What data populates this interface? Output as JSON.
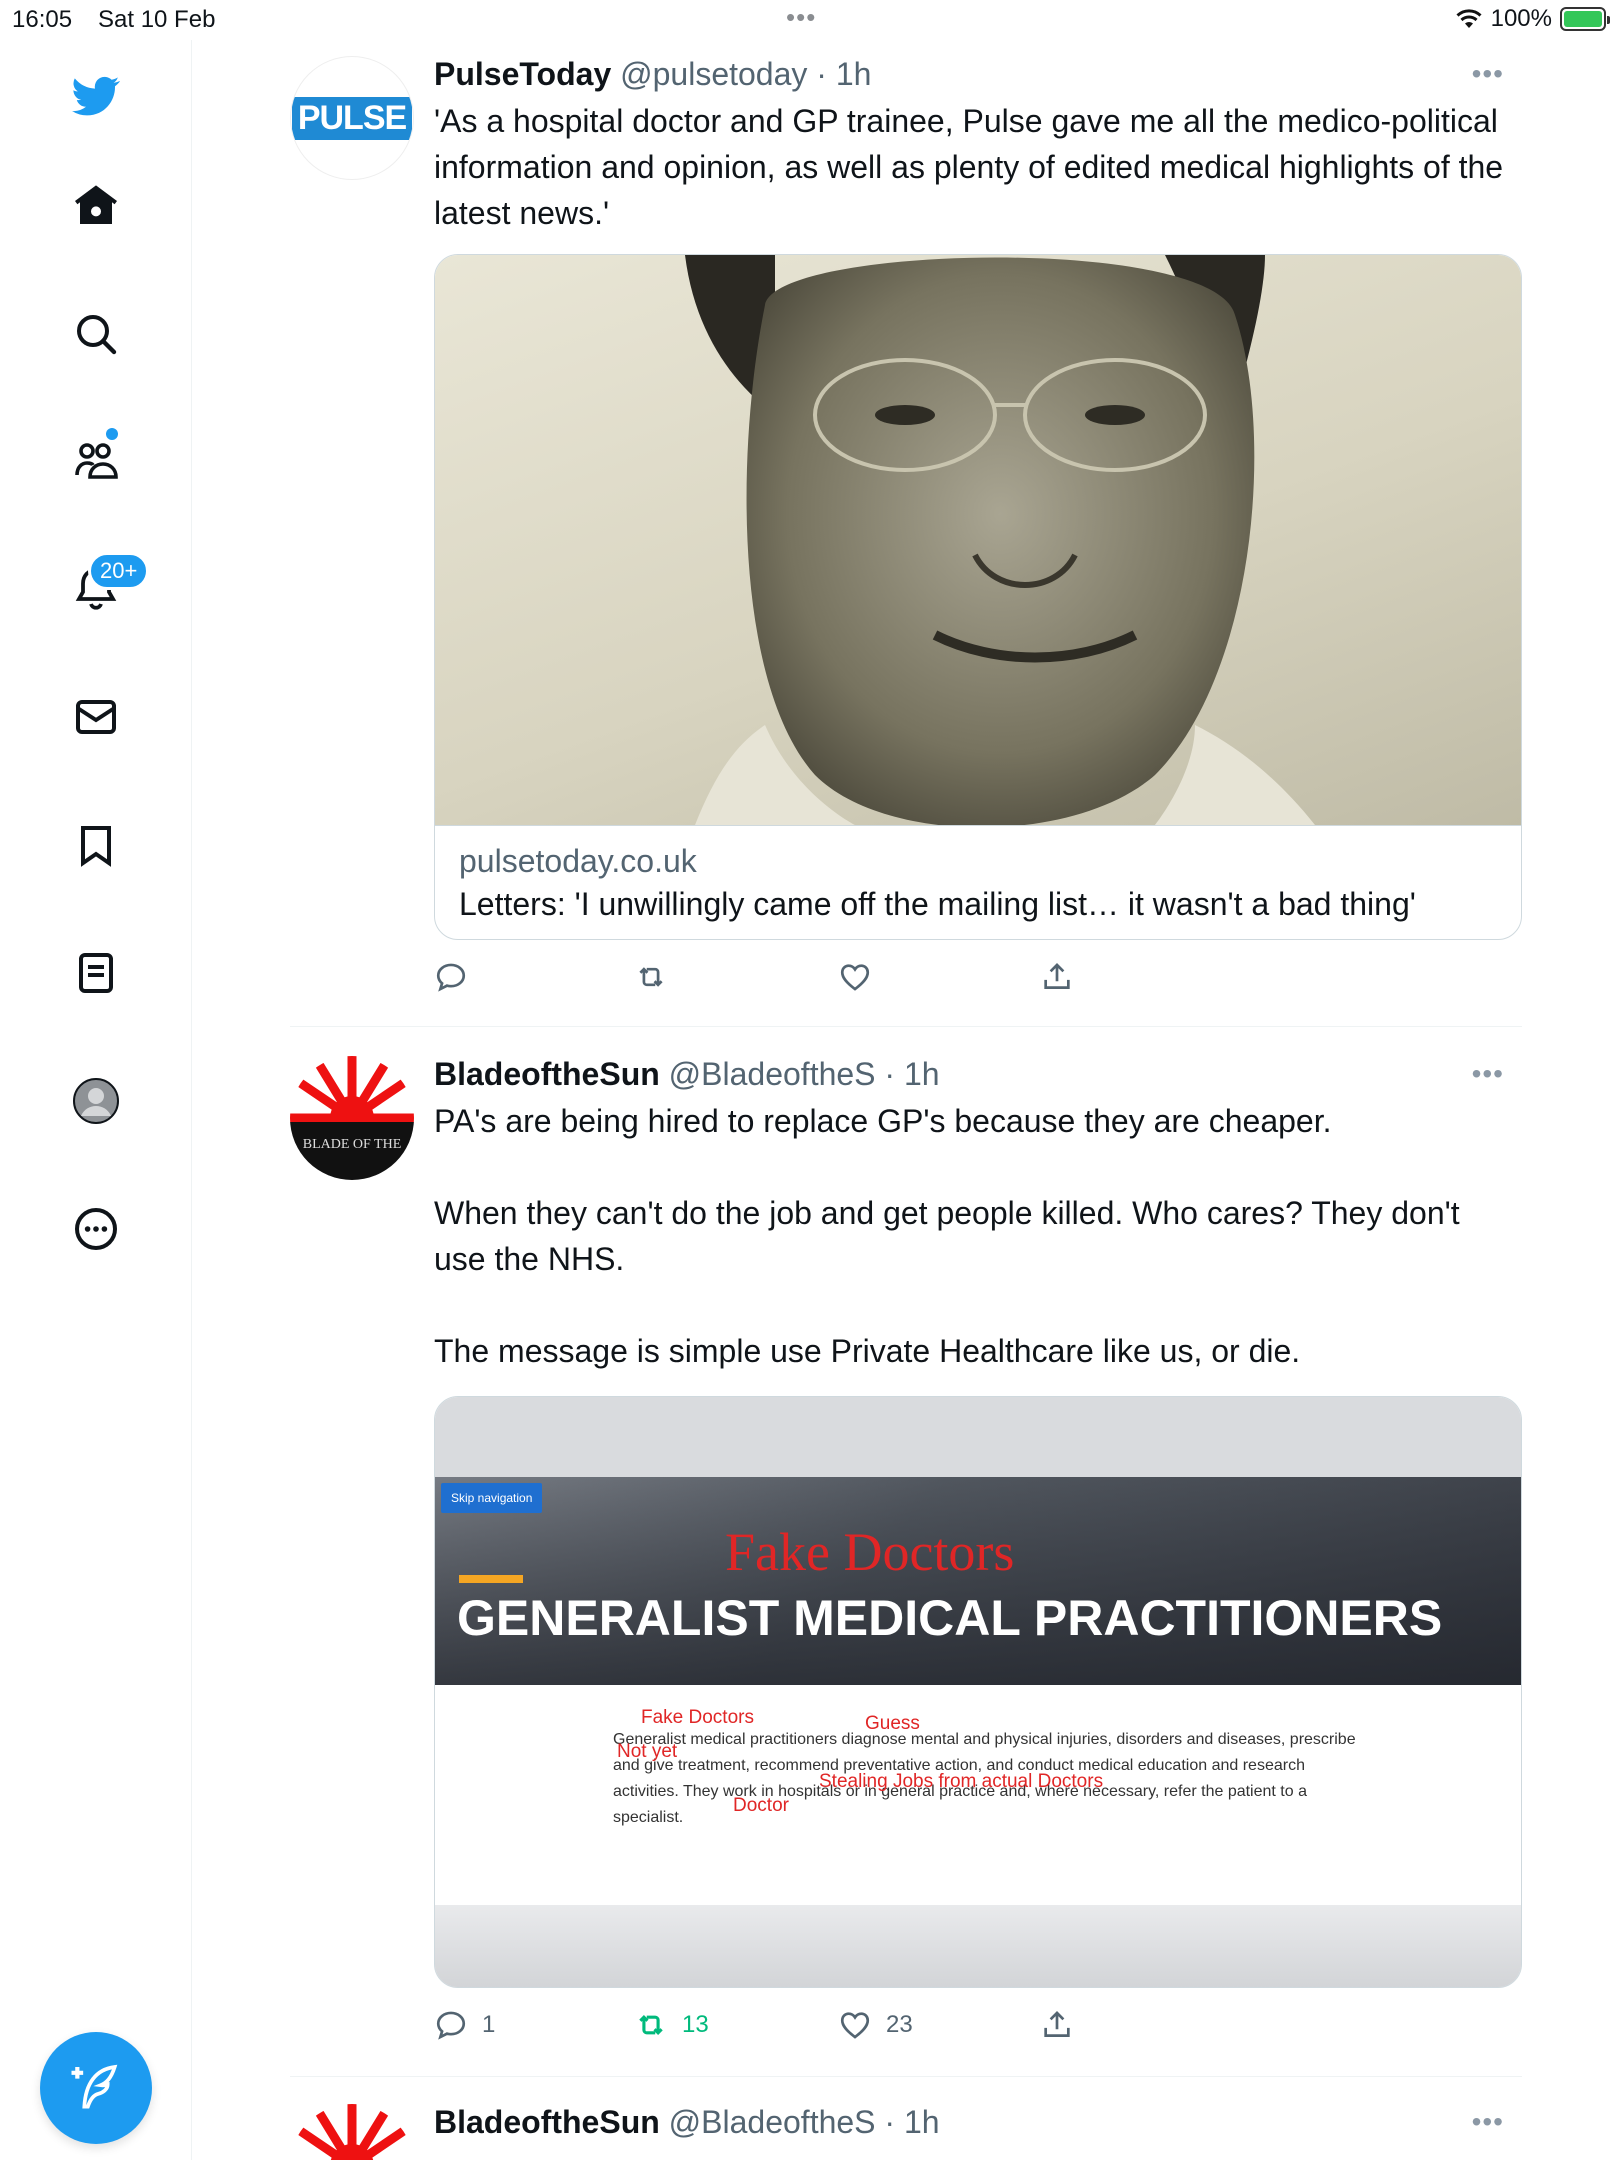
{
  "status_bar": {
    "time": "16:05",
    "date": "Sat 10 Feb",
    "battery": "100%",
    "battery_level": 1.0
  },
  "sidebar": {
    "items": [
      {
        "name": "twitter-logo",
        "icon": "bird-icon"
      },
      {
        "name": "home",
        "icon": "home-icon"
      },
      {
        "name": "explore",
        "icon": "search-icon"
      },
      {
        "name": "communities",
        "icon": "people-icon"
      },
      {
        "name": "notifications",
        "icon": "bell-icon"
      },
      {
        "name": "messages",
        "icon": "mail-icon"
      },
      {
        "name": "bookmarks",
        "icon": "bookmark-icon"
      },
      {
        "name": "lists",
        "icon": "list-icon"
      },
      {
        "name": "profile",
        "icon": "avatar-icon"
      },
      {
        "name": "more",
        "icon": "more-circle-icon"
      }
    ],
    "notifications_badge": "20+",
    "accent": "#1d9bf0"
  },
  "tweets": [
    {
      "name": "PulseToday",
      "handle": "@pulsetoday",
      "time": "· 1h",
      "avatar_text": "PULSE",
      "text": "'As a hospital doctor and GP trainee, Pulse gave me all the medico-political information and opinion, as well as plenty of edited medical highlights of the latest news.'",
      "link_domain": "pulsetoday.co.uk",
      "link_title": "Letters: 'I unwillingly came off the mailing list… it wasn't a bad thing'",
      "counts": {
        "reply": "",
        "retweet": "",
        "like": ""
      }
    },
    {
      "name": "BladeoftheSun",
      "handle": "@BladeoftheS",
      "time": "· 1h",
      "avatar_text": "BLADE OF THE",
      "text_lines": [
        "PA's are being hired to replace GP's because they are cheaper.",
        "When they can't do the job and get people killed. Who cares? They don't use the NHS.",
        "The message is simple use Private Healthcare like us, or die."
      ],
      "image": {
        "skip_label": "Skip navigation",
        "overlay_title": "Fake Doctors",
        "heading": "GENERALIST MEDICAL PRACTITIONERS",
        "paragraph": "Generalist medical practitioners diagnose mental and physical injuries, disorders and diseases, prescribe and give treatment, recommend preventative action, and conduct medical education and research activities. They work in hospitals or in general practice and, where necessary, refer the patient to a specialist.",
        "annotations": [
          "Fake Doctors",
          "Guess",
          "Not yet",
          "Stealing Jobs from actual Doctors",
          "Doctor"
        ]
      },
      "counts": {
        "reply": "1",
        "retweet": "13",
        "like": "23"
      }
    },
    {
      "name": "BladeoftheSun",
      "handle": "@BladeoftheS",
      "time": "· 1h"
    }
  ]
}
